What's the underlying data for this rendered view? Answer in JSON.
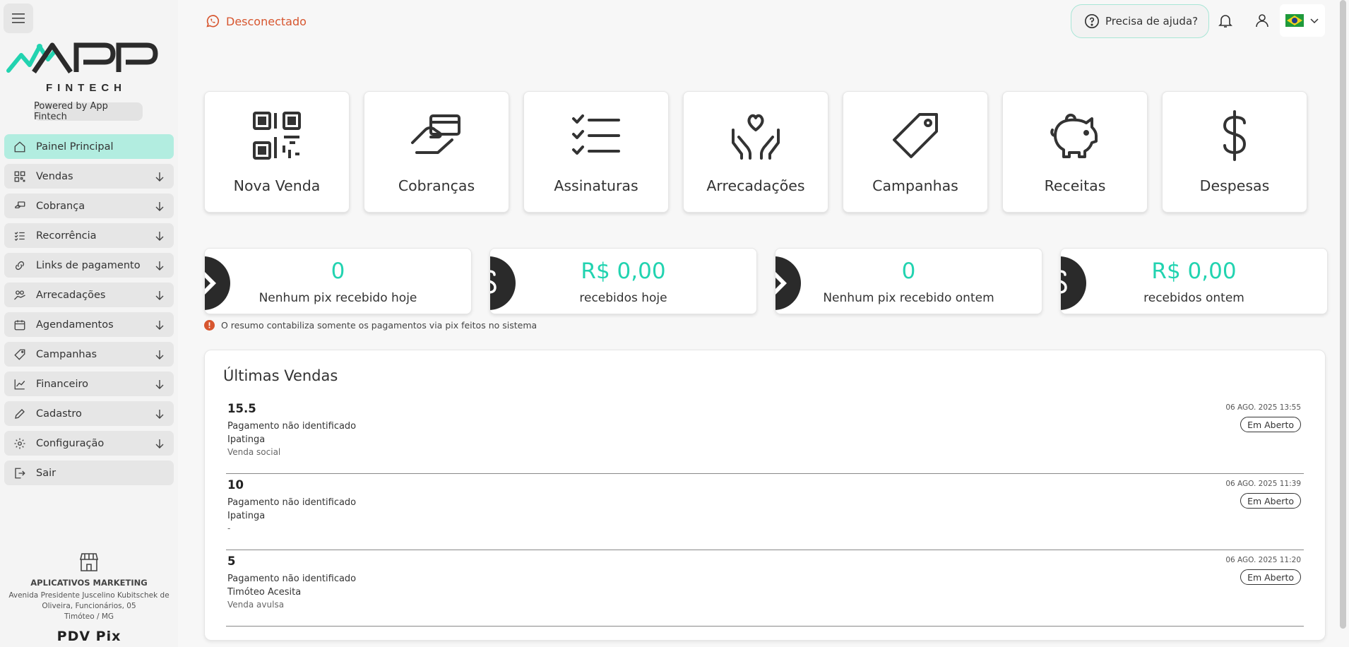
{
  "brand": {
    "logo_main": "APP",
    "logo_sub": "FINTECH",
    "powered_by": "Powered by App Fintech",
    "accent": "#22d3b0",
    "active_bg": "#b2ede0"
  },
  "sidebar": {
    "items": [
      {
        "label": "Painel Principal",
        "icon": "home-icon"
      },
      {
        "label": "Vendas",
        "icon": "qr-icon"
      },
      {
        "label": "Cobrança",
        "icon": "hand-card-icon"
      },
      {
        "label": "Recorrência",
        "icon": "list-check-icon"
      },
      {
        "label": "Links de pagamento",
        "icon": "link-icon"
      },
      {
        "label": "Arrecadações",
        "icon": "donate-icon"
      },
      {
        "label": "Agendamentos",
        "icon": "calendar-icon"
      },
      {
        "label": "Campanhas",
        "icon": "tag-icon"
      },
      {
        "label": "Financeiro",
        "icon": "chart-icon"
      },
      {
        "label": "Cadastro",
        "icon": "pencil-icon"
      },
      {
        "label": "Configuração",
        "icon": "gear-icon"
      },
      {
        "label": "Sair",
        "icon": "logout-icon"
      }
    ]
  },
  "company": {
    "name": "APLICATIVOS MARKETING",
    "address_line1": "Avenida Presidente Juscelino Kubitschek de",
    "address_line2": "Oliveira, Funcionários, 05",
    "address_line3": "Timóteo / MG",
    "product": "PDV Pix"
  },
  "topbar": {
    "status": "Desconectado",
    "status_color": "#d7562f",
    "help_label": "Precisa de ajuda?"
  },
  "tiles": [
    {
      "label": "Nova Venda",
      "icon": "qrcode-icon"
    },
    {
      "label": "Cobranças",
      "icon": "hand-card-icon"
    },
    {
      "label": "Assinaturas",
      "icon": "list-check-icon"
    },
    {
      "label": "Arrecadações",
      "icon": "hands-heart-icon"
    },
    {
      "label": "Campanhas",
      "icon": "tag-icon"
    },
    {
      "label": "Receitas",
      "icon": "piggy-bank-icon"
    },
    {
      "label": "Despesas",
      "icon": "dollar-icon"
    }
  ],
  "stats": [
    {
      "value": "0",
      "label": "Nenhum pix recebido hoje",
      "icon": "pix-icon"
    },
    {
      "value": "R$ 0,00",
      "label": "recebidos hoje",
      "icon": "dollar-icon"
    },
    {
      "value": "0",
      "label": "Nenhum pix recebido ontem",
      "icon": "pix-icon"
    },
    {
      "value": "R$ 0,00",
      "label": "recebidos ontem",
      "icon": "dollar-icon"
    }
  ],
  "info_note": "O resumo contabiliza somente os pagamentos via pix feitos no sistema",
  "sales": {
    "title": "Últimas Vendas",
    "rows": [
      {
        "amount": "15.5",
        "desc": "Pagamento não identificado",
        "city": "Ipatinga",
        "type": "Venda social",
        "date": "06 AGO. 2025 13:55",
        "status": "Em Aberto"
      },
      {
        "amount": "10",
        "desc": "Pagamento não identificado",
        "city": "Ipatinga",
        "type": "-",
        "date": "06 AGO. 2025 11:39",
        "status": "Em Aberto"
      },
      {
        "amount": "5",
        "desc": "Pagamento não identificado",
        "city": "Timóteo Acesita",
        "type": "Venda avulsa",
        "date": "06 AGO. 2025 11:20",
        "status": "Em Aberto"
      }
    ]
  }
}
